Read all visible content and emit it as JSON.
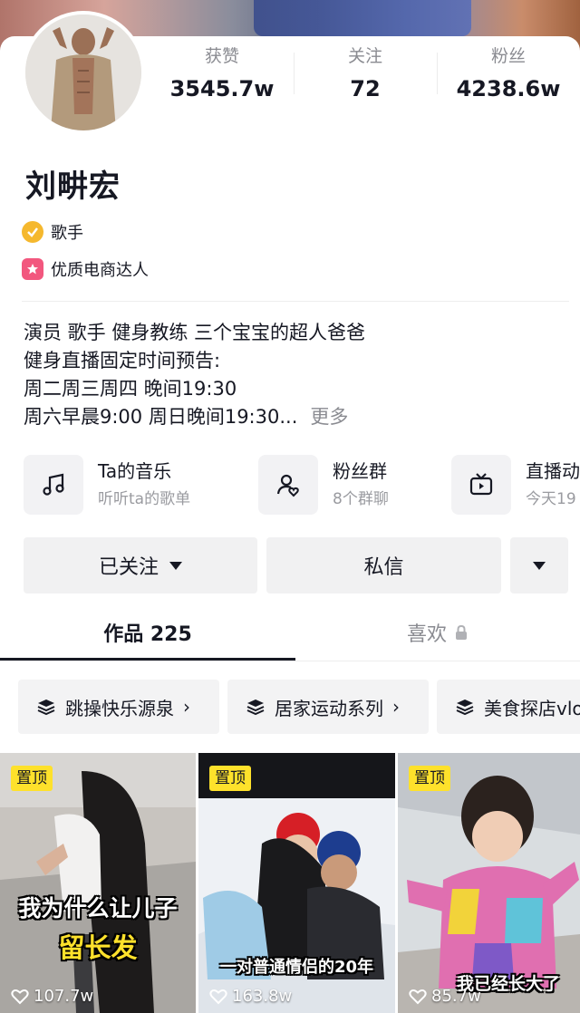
{
  "profile": {
    "name": "刘畊宏",
    "badges": [
      {
        "label": "歌手",
        "icon": "verified-check-icon",
        "color": "#f5b82e"
      },
      {
        "label": "优质电商达人",
        "icon": "star-badge-icon",
        "color": "#f2577e"
      }
    ],
    "stats": [
      {
        "label": "获赞",
        "value": "3545.7w"
      },
      {
        "label": "关注",
        "value": "72"
      },
      {
        "label": "粉丝",
        "value": "4238.6w"
      }
    ],
    "bio": {
      "line1": "演员  歌手  健身教练  三个宝宝的超人爸爸",
      "line2": "健身直播固定时间预告:",
      "line3": "周二周三周四 晚间19:30",
      "line4": "周六早晨9:00 周日晚间19:30...",
      "more": "更多"
    }
  },
  "entries": [
    {
      "title": "Ta的音乐",
      "subtitle": "听听ta的歌单",
      "icon": "music-note-icon"
    },
    {
      "title": "粉丝群",
      "subtitle": "8个群聊",
      "icon": "fan-group-icon"
    },
    {
      "title": "直播动",
      "subtitle": "今天19",
      "icon": "tv-icon"
    }
  ],
  "actions": {
    "followed": "已关注",
    "message": "私信"
  },
  "tabs": {
    "works": "作品 225",
    "likes": "喜欢"
  },
  "collections": [
    {
      "label": "跳操快乐源泉"
    },
    {
      "label": "居家运动系列"
    },
    {
      "label": "美食探店vlo"
    }
  ],
  "videos": [
    {
      "pin": "置顶",
      "caption1": "我为什么让儿子",
      "caption2": "留长发",
      "likes": "107.7w"
    },
    {
      "pin": "置顶",
      "caption1": "一对普通情侣的20年",
      "likes": "163.8w"
    },
    {
      "pin": "置顶",
      "caption1": "我已经长大了",
      "likes": "85.7w"
    }
  ],
  "colors": {
    "pin": "#fee12b",
    "caption_highlight": "#fee12b",
    "text": "#161823",
    "muted": "#8a8b91"
  }
}
